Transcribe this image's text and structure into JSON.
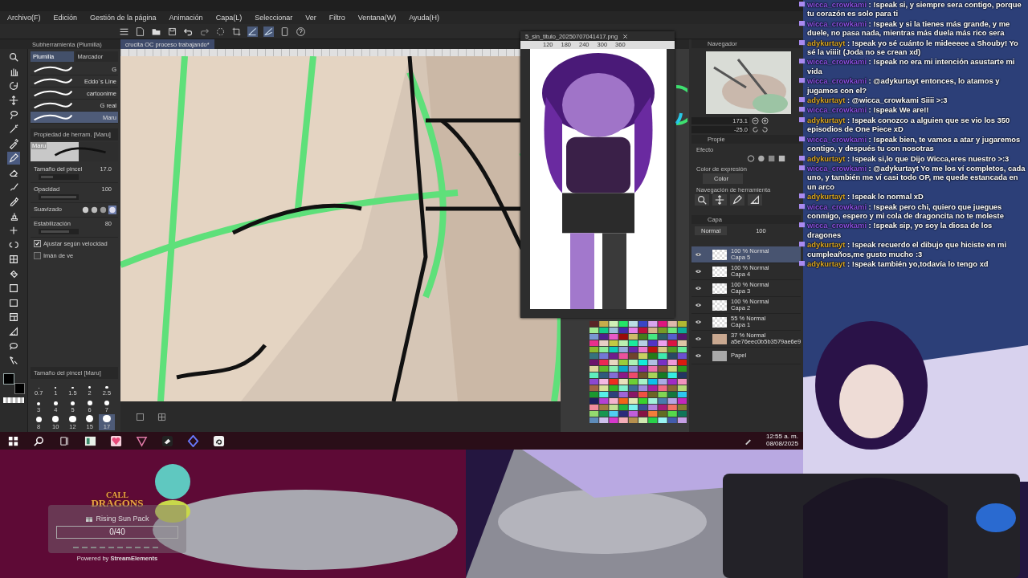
{
  "menu": [
    "Archivo(F)",
    "Edición",
    "Gestión de la página",
    "Animación",
    "Capa(L)",
    "Seleccionar",
    "Ver",
    "Filtro",
    "Ventana(W)",
    "Ayuda(H)"
  ],
  "tools": [
    {
      "kind": "zoom",
      "selected": false
    },
    {
      "kind": "hand",
      "selected": false
    },
    {
      "kind": "rotate",
      "selected": false
    },
    {
      "kind": "move",
      "selected": false
    },
    {
      "kind": "lasso",
      "selected": false
    },
    {
      "kind": "wand",
      "selected": false
    },
    {
      "kind": "dropper",
      "selected": false
    },
    {
      "kind": "pen",
      "selected": true
    },
    {
      "kind": "eraser",
      "selected": false
    },
    {
      "kind": "brush",
      "selected": false
    },
    {
      "kind": "marker",
      "selected": false
    },
    {
      "kind": "stamp",
      "selected": false
    },
    {
      "kind": "plus",
      "selected": false
    },
    {
      "kind": "blend",
      "selected": false
    },
    {
      "kind": "grid",
      "selected": false
    },
    {
      "kind": "fill",
      "selected": false
    },
    {
      "kind": "gradient",
      "selected": false
    },
    {
      "kind": "rect",
      "selected": false
    },
    {
      "kind": "frame",
      "selected": false
    },
    {
      "kind": "ruler",
      "selected": false
    },
    {
      "kind": "balloon",
      "selected": false
    },
    {
      "kind": "correct",
      "selected": false
    }
  ],
  "subtool_panel": {
    "title": "Subherramienta (Plumilla)",
    "tabs": [
      {
        "label": "Plumilla",
        "selected": true
      },
      {
        "label": "Marcador",
        "selected": false
      }
    ],
    "brushes": [
      {
        "name": "G",
        "selected": false
      },
      {
        "name": "Eddo´s Line",
        "selected": false
      },
      {
        "name": "cartoonime",
        "selected": false
      },
      {
        "name": "G real",
        "selected": false
      },
      {
        "name": "Maru",
        "selected": true
      }
    ]
  },
  "tool_property": {
    "title": "Propiedad de herram. [Maru]",
    "preview_label": "Maru",
    "settings": [
      {
        "kind": "slider",
        "label": "Tamaño del pincel",
        "value": "17.0",
        "level": 0.35
      },
      {
        "kind": "slider",
        "label": "Opacidad",
        "value": "100",
        "level": 1
      },
      {
        "kind": "smoothing",
        "label": "Suavizado"
      },
      {
        "kind": "slider",
        "label": "Estabilización",
        "value": "80",
        "level": 0.8
      },
      {
        "kind": "checkbox",
        "label": "Ajustar según velocidad",
        "checked": true
      },
      {
        "kind": "checkbox",
        "label": "Imán de ve",
        "checked": false
      }
    ]
  },
  "brush_size": {
    "title": "Tamaño del pincel [Maru]",
    "sizes": [
      {
        "label": "0.7",
        "selected": false
      },
      {
        "label": "1",
        "selected": false
      },
      {
        "label": "1.5",
        "selected": false
      },
      {
        "label": "2",
        "selected": false
      },
      {
        "label": "2.5",
        "selected": false
      },
      {
        "label": "3",
        "selected": false
      },
      {
        "label": "4",
        "selected": false
      },
      {
        "label": "5",
        "selected": false
      },
      {
        "label": "6",
        "selected": false
      },
      {
        "label": "7",
        "selected": false
      },
      {
        "label": "8",
        "selected": false
      },
      {
        "label": "10",
        "selected": false
      },
      {
        "label": "12",
        "selected": false
      },
      {
        "label": "15",
        "selected": false
      },
      {
        "label": "17",
        "selected": true
      }
    ]
  },
  "document_tab": {
    "title": "crucita OC proceso trabajando*"
  },
  "image_window": {
    "tab": "5_sin_titulo_20250707041417.png",
    "ruler": [
      "120",
      "180",
      "240",
      "300",
      "360"
    ]
  },
  "navigator": {
    "title": "Navegador",
    "zoom": "173.1",
    "rotation": "-25.0"
  },
  "properties": {
    "tab": "Propie",
    "effect": "Efecto",
    "color_label": "Color de expresión",
    "color_value": "Color",
    "tool_nav": "Navegación de herramienta"
  },
  "layers": {
    "title": "Capa",
    "blend": "Normal",
    "opacity": "100",
    "items": [
      {
        "mode": "100 % Normal",
        "name": "Capa 5",
        "kind": "raster",
        "selected": true,
        "visible": true
      },
      {
        "mode": "100 % Normal",
        "name": "Capa 4",
        "kind": "raster",
        "selected": false,
        "visible": true
      },
      {
        "mode": "100 % Normal",
        "name": "Capa 3",
        "kind": "raster",
        "selected": false,
        "visible": true
      },
      {
        "mode": "100 % Normal",
        "name": "Capa 2",
        "kind": "raster",
        "selected": false,
        "visible": true
      },
      {
        "mode": "55 % Normal",
        "name": "Capa 1",
        "kind": "raster",
        "selected": false,
        "visible": true
      },
      {
        "mode": "37 % Normal",
        "name": "a5e76eec0b5b3579ae6e9",
        "selected": false,
        "visible": true
      },
      {
        "name": "Papel",
        "kind": "paper",
        "selected": false,
        "visible": true
      }
    ]
  },
  "taskbar": {
    "time": "12:55 a. m.",
    "date": "08/08/2025"
  },
  "chat": [
    {
      "user": "wicca_crowkami",
      "color": "#8a4fe0",
      "text": ": !speak si, y siempre sera contigo, porque tu corazón es solo para ti"
    },
    {
      "user": "wicca_crowkami",
      "color": "#8a4fe0",
      "text": ": !speak y si la tienes más grande, y me duele, no pasa nada, mientras más duela más rico sera"
    },
    {
      "user": "adykurtayt",
      "color": "#d9a520",
      "text": ": !speak yo sé cuánto le mideeeee a Shouby! Yo sé la viiii! (Joda no se crean xd)"
    },
    {
      "user": "wicca_crowkami",
      "color": "#8a4fe0",
      "text": ": !speak no era mi intención asustarte mi vida"
    },
    {
      "user": "wicca_crowkami",
      "color": "#8a4fe0",
      "text": ": @adykurtayt entonces, lo atamos y jugamos con el?"
    },
    {
      "user": "adykurtayt",
      "color": "#d9a520",
      "text": ": @wicca_crowkami Siiii >:3"
    },
    {
      "user": "wicca_crowkami",
      "color": "#8a4fe0",
      "text": ": !speak We are!!"
    },
    {
      "user": "adykurtayt",
      "color": "#d9a520",
      "text": ": !speak conozco a alguien que se vio los 350 episodios de One Piece xD"
    },
    {
      "user": "wicca_crowkami",
      "color": "#8a4fe0",
      "text": ": !speak bien, te vamos a atar y jugaremos contigo, y después tu con nosotras"
    },
    {
      "user": "adykurtayt",
      "color": "#d9a520",
      "text": ": !speak si,lo que Dijo Wicca,eres nuestro >:3"
    },
    {
      "user": "wicca_crowkami",
      "color": "#8a4fe0",
      "text": ": @adykurtayt Yo me los ví completos, cada uno, y también me ví casi todo OP, me quede estancada en un arco"
    },
    {
      "user": "adykurtayt",
      "color": "#d9a520",
      "text": ": !speak lo normal xD"
    },
    {
      "user": "wicca_crowkami",
      "color": "#8a4fe0",
      "text": ": !speak pero chi, quiero que juegues conmigo, espero y mi cola de dragoncita no te moleste"
    },
    {
      "user": "wicca_crowkami",
      "color": "#8a4fe0",
      "text": ": !speak sip, yo soy la diosa de los dragones"
    },
    {
      "user": "adykurtayt",
      "color": "#d9a520",
      "text": ": !speak recuerdo el dibujo que hiciste en mi cumpleaños,me gusto mucho :3"
    },
    {
      "user": "adykurtayt",
      "color": "#d9a520",
      "text": ": !speak también yo,todavía lo tengo xd"
    }
  ],
  "widget": {
    "logo": [
      "CALL",
      "DRAGONS"
    ],
    "title": "Rising Sun Pack",
    "progress": "0/40",
    "level": 0,
    "footer": "Powered by **StreamElements**"
  }
}
